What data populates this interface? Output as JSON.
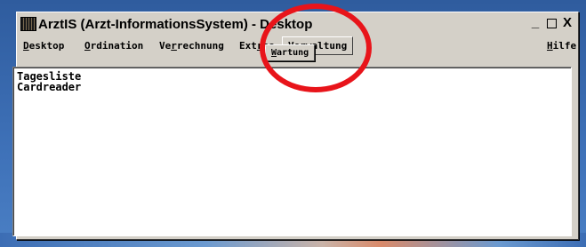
{
  "window": {
    "title": "ArztIS (Arzt-InformationsSystem) - Desktop",
    "buttons": {
      "minimize": "_",
      "close": "X"
    }
  },
  "menubar": {
    "items": [
      {
        "pre": "",
        "acc": "D",
        "post": "esktop"
      },
      {
        "pre": "",
        "acc": "O",
        "post": "rdination"
      },
      {
        "pre": "Ve",
        "acc": "r",
        "post": "rechnung"
      },
      {
        "pre": "Ext",
        "acc": "r",
        "post": "as"
      },
      {
        "pre": "Ver",
        "acc": "w",
        "post": "altung"
      },
      {
        "pre": "",
        "acc": "H",
        "post": "ilfe"
      }
    ]
  },
  "dropdown": {
    "items": [
      {
        "pre": "",
        "acc": "W",
        "post": "artung"
      }
    ]
  },
  "list": {
    "items": [
      "Tagesliste",
      "Cardreader"
    ]
  },
  "colors": {
    "annotation_circle": "#e8141a",
    "window_face": "#d4d0c8",
    "desktop": "#3e71b8"
  }
}
